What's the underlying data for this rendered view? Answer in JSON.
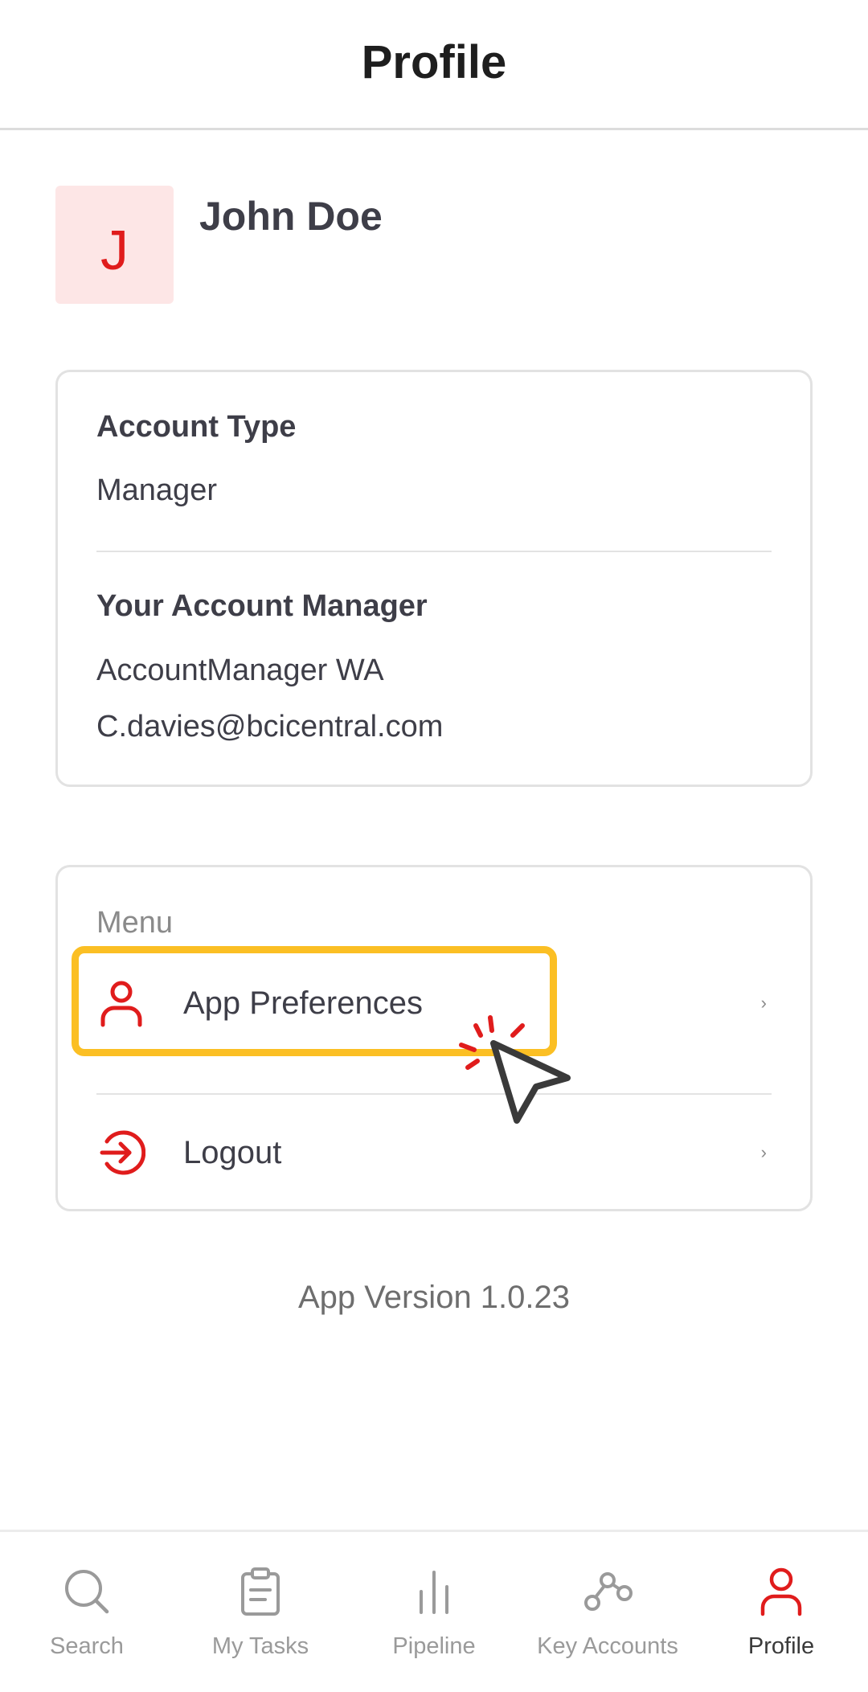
{
  "header": {
    "title": "Profile"
  },
  "profile": {
    "avatar_initial": "J",
    "name": "John Doe"
  },
  "account": {
    "type_label": "Account Type",
    "type_value": "Manager",
    "manager_label": "Your Account Manager",
    "manager_name": "AccountManager WA",
    "manager_email": "C.davies@bcicentral.com"
  },
  "menu": {
    "heading": "Menu",
    "items": [
      {
        "label": "App Preferences",
        "icon": "user-icon",
        "chevron": "›"
      },
      {
        "label": "Logout",
        "icon": "logout-icon",
        "chevron": "›"
      }
    ]
  },
  "app_version": "App Version 1.0.23",
  "bottom_nav": {
    "items": [
      {
        "label": "Search",
        "icon": "search-icon",
        "active": false
      },
      {
        "label": "My Tasks",
        "icon": "clipboard-icon",
        "active": false
      },
      {
        "label": "Pipeline",
        "icon": "bar-chart-icon",
        "active": false
      },
      {
        "label": "Key Accounts",
        "icon": "network-icon",
        "active": false
      },
      {
        "label": "Profile",
        "icon": "user-icon",
        "active": true
      }
    ]
  },
  "colors": {
    "accent": "#e01c1c",
    "highlight": "#fbbf24",
    "avatar_bg": "#fde6e6",
    "inactive": "#9a9a9a",
    "text": "#3e3e48"
  }
}
